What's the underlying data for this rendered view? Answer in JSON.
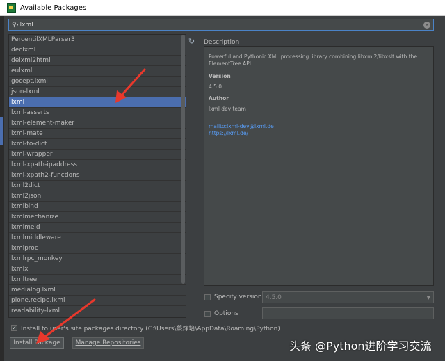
{
  "window": {
    "title": "Available Packages"
  },
  "search": {
    "value": "lxml"
  },
  "packages": [
    "PercentilXMLParser3",
    "declxml",
    "delxml2html",
    "eulxml",
    "gocept.lxml",
    "json-lxml",
    "lxml",
    "lxml-asserts",
    "lxml-element-maker",
    "lxml-mate",
    "lxml-to-dict",
    "lxml-wrapper",
    "lxml-xpath-ipaddress",
    "lxml-xpath2-functions",
    "lxml2dict",
    "lxml2json",
    "lxmlbind",
    "lxmlmechanize",
    "lxmlmeld",
    "lxmlmiddleware",
    "lxmlproc",
    "lxmlrpc_monkey",
    "lxmlx",
    "lxmltree",
    "medialog.lxml",
    "plone.recipe.lxml",
    "readability-lxml"
  ],
  "selected_package": "lxml",
  "description": {
    "label": "Description",
    "text": "Powerful and Pythonic XML processing library combining libxml2/libxslt with the ElementTree API",
    "version_heading": "Version",
    "version": "4.5.0",
    "author_heading": "Author",
    "author": "lxml dev team",
    "link1": "mailto:lxml-dev@lxml.de",
    "link2": "https://lxml.de/"
  },
  "specify_version": {
    "label": "Specify version",
    "value": "4.5.0",
    "checked": false
  },
  "options": {
    "label": "Options",
    "checked": false
  },
  "install_to_user": {
    "label": "Install to user's site packages directory (C:\\Users\\蔡烽培\\AppData\\Roaming\\Python)",
    "checked": true
  },
  "buttons": {
    "install": "Install Package",
    "manage": "Manage Repositories"
  },
  "watermark": "头条 @Python进阶学习交流",
  "colors": {
    "selection": "#4b6eaf",
    "link": "#589df6",
    "arrow": "#e8382c"
  }
}
